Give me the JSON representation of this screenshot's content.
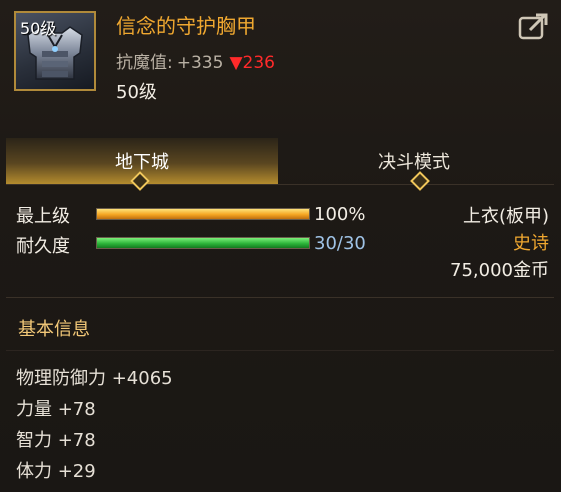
{
  "item": {
    "level_badge": "50级",
    "name": "信念的守护胸甲",
    "stat": {
      "label": "抗魔值:",
      "value": "+335",
      "diff_arrow": "▼",
      "diff_value": "236"
    },
    "level_text": "50级",
    "icon": "armor-chestplate-icon"
  },
  "tabs": [
    {
      "label": "地下城",
      "active": true
    },
    {
      "label": "决斗模式",
      "active": false
    }
  ],
  "bars": {
    "upgrade": {
      "label": "最上级",
      "value_text": "100%",
      "fill": 1.0,
      "color": "#f5a623"
    },
    "durability": {
      "label": "耐久度",
      "value_text": "30/30",
      "fill": 1.0,
      "color": "#2db53a"
    }
  },
  "right_info": {
    "slot": "上衣(板甲)",
    "rarity": "史诗",
    "price": "75,000金币"
  },
  "section": {
    "title": "基本信息"
  },
  "attributes": [
    "物理防御力 +4065",
    "力量 +78",
    "智力 +78",
    "体力 +29"
  ],
  "colors": {
    "name": "#f0a830",
    "rarity": "#f0a830",
    "diff_down": "#ff2a2a",
    "durability_value": "#9fc3e6"
  }
}
